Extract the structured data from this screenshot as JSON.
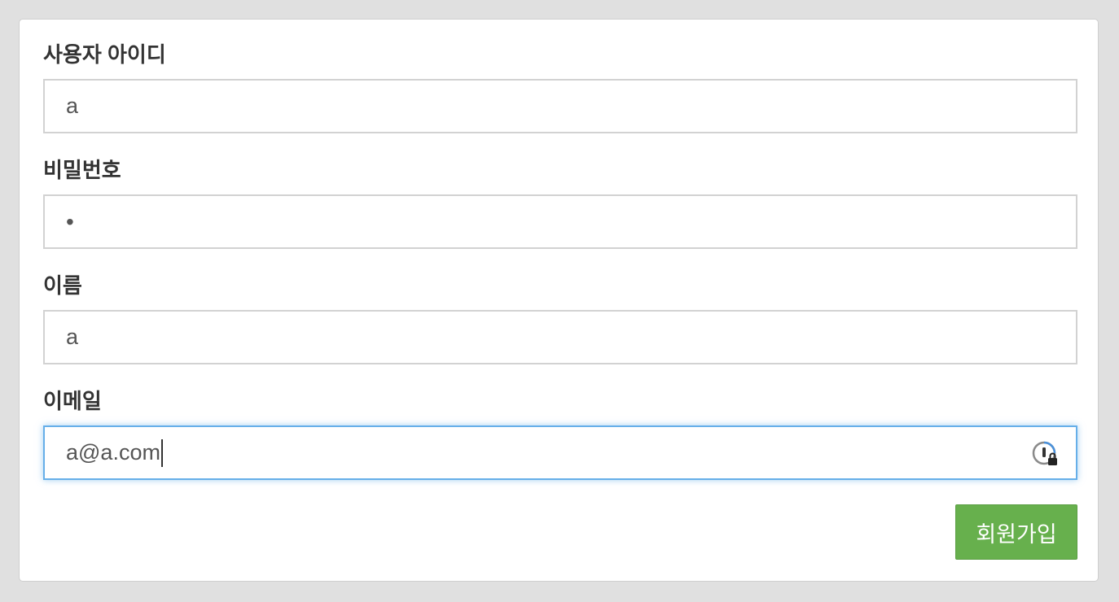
{
  "form": {
    "username": {
      "label": "사용자 아이디",
      "value": "a"
    },
    "password": {
      "label": "비밀번호",
      "masked_value": "•"
    },
    "name": {
      "label": "이름",
      "value": "a"
    },
    "email": {
      "label": "이메일",
      "value": "a@a.com"
    },
    "submit_label": "회원가입"
  },
  "colors": {
    "background": "#e0e0e0",
    "focus_border": "#66afe9",
    "submit_button": "#67b04d",
    "label_text": "#333333"
  },
  "icons": {
    "password_manager": "password-manager-lock-icon"
  }
}
